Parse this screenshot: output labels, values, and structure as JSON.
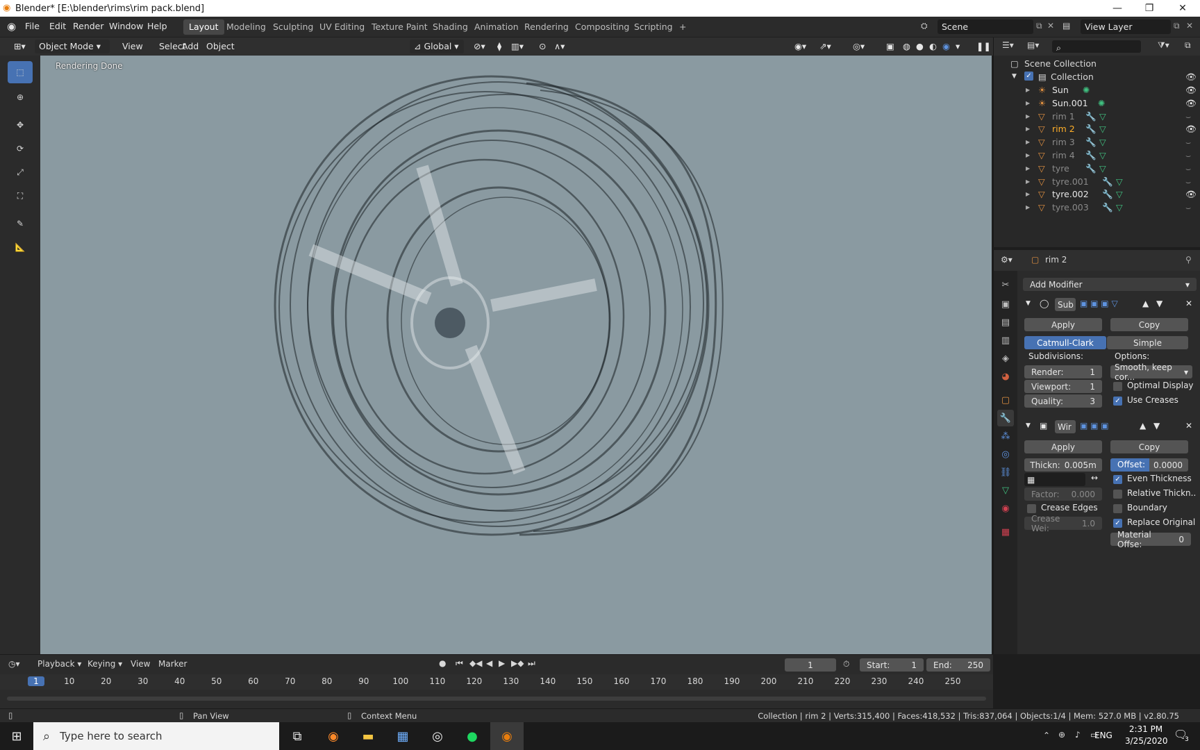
{
  "window": {
    "title": "Blender* [E:\\blender\\rims\\rim pack.blend]"
  },
  "menu": [
    "File",
    "Edit",
    "Render",
    "Window",
    "Help"
  ],
  "workspaces": [
    "Layout",
    "Modeling",
    "Sculpting",
    "UV Editing",
    "Texture Paint",
    "Shading",
    "Animation",
    "Rendering",
    "Compositing",
    "Scripting"
  ],
  "active_workspace": "Layout",
  "scene": {
    "name": "Scene",
    "view_layer": "View Layer"
  },
  "header3d": {
    "mode": "Object Mode",
    "view": "View",
    "select": "Select",
    "add": "Add",
    "object": "Object",
    "orientation": "Global"
  },
  "viewport": {
    "status": "Rendering Done"
  },
  "outliner": {
    "root": "Scene Collection",
    "collection": "Collection",
    "items": [
      {
        "name": "Sun",
        "type": "light",
        "visible": true,
        "dim": false
      },
      {
        "name": "Sun.001",
        "type": "light",
        "visible": true,
        "dim": false
      },
      {
        "name": "rim 1",
        "type": "mesh",
        "visible": false,
        "dim": true
      },
      {
        "name": "rim 2",
        "type": "mesh",
        "visible": true,
        "dim": false,
        "selected": true
      },
      {
        "name": "rim 3",
        "type": "mesh",
        "visible": false,
        "dim": true
      },
      {
        "name": "rim 4",
        "type": "mesh",
        "visible": false,
        "dim": true
      },
      {
        "name": "tyre",
        "type": "mesh",
        "visible": false,
        "dim": true
      },
      {
        "name": "tyre.001",
        "type": "mesh",
        "visible": false,
        "dim": true
      },
      {
        "name": "tyre.002",
        "type": "mesh",
        "visible": true,
        "dim": false
      },
      {
        "name": "tyre.003",
        "type": "mesh",
        "visible": false,
        "dim": true
      }
    ]
  },
  "properties": {
    "object_name": "rim 2",
    "add_modifier": "Add Modifier",
    "subsurf": {
      "name": "Sub",
      "apply": "Apply",
      "copy": "Copy",
      "catmull": "Catmull-Clark",
      "simple": "Simple",
      "subdivisions_label": "Subdivisions:",
      "options_label": "Options:",
      "render_label": "Render:",
      "render_value": "1",
      "viewport_label": "Viewport:",
      "viewport_value": "1",
      "quality_label": "Quality:",
      "quality_value": "3",
      "uv_smooth": "Smooth, keep cor...",
      "optimal_display": "Optimal Display",
      "use_creases": "Use Creases"
    },
    "wireframe": {
      "name": "Wir",
      "apply": "Apply",
      "copy": "Copy",
      "thickness_label": "Thickn:",
      "thickness_value": "0.005m",
      "offset_label": "Offset:",
      "offset_value": "0.0000",
      "even_thickness": "Even Thickness",
      "factor_label": "Factor:",
      "factor_value": "0.000",
      "relative_thickness": "Relative Thickn..",
      "crease_edges": "Crease Edges",
      "boundary": "Boundary",
      "crease_weight_label": "Crease Wei:",
      "crease_weight_value": "1.0",
      "replace_original": "Replace Original",
      "material_offset_label": "Material Offse:",
      "material_offset_value": "0"
    }
  },
  "timeline": {
    "menus": [
      "Playback",
      "Keying",
      "View",
      "Marker"
    ],
    "current_frame": "1",
    "start_label": "Start:",
    "start": "1",
    "end_label": "End:",
    "end": "250",
    "ticks": [
      "1",
      "10",
      "20",
      "30",
      "40",
      "50",
      "60",
      "70",
      "80",
      "90",
      "100",
      "110",
      "120",
      "130",
      "140",
      "150",
      "160",
      "170",
      "180",
      "190",
      "200",
      "210",
      "220",
      "230",
      "240",
      "250"
    ]
  },
  "statusbar": {
    "pan": "Pan View",
    "context": "Context Menu",
    "stats": "Collection | rim 2 | Verts:315,400 | Faces:418,532 | Tris:837,064 | Objects:1/4 | Mem: 527.0 MB | v2.80.75"
  },
  "taskbar": {
    "search_placeholder": "Type here to search",
    "lang": "ENG",
    "time": "2:31 PM",
    "date": "3/25/2020",
    "notif_count": "3"
  }
}
